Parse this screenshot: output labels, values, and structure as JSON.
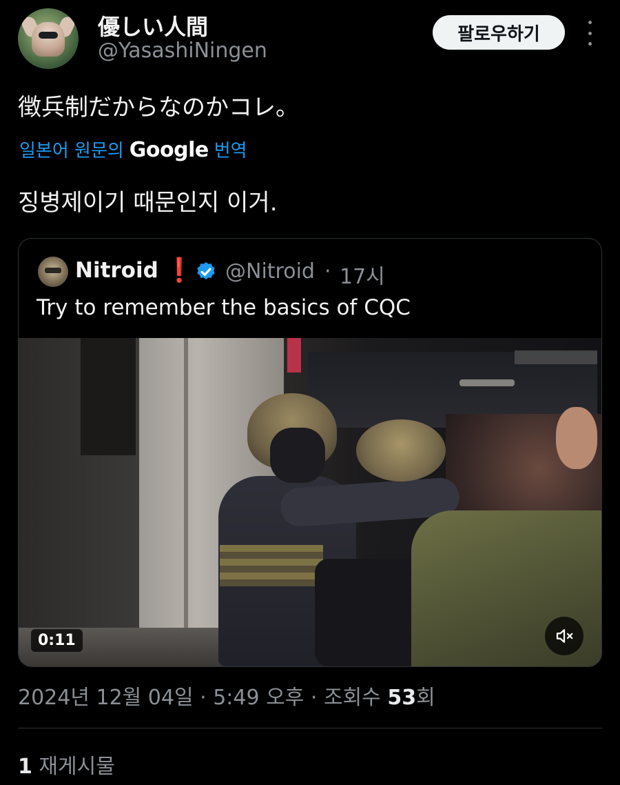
{
  "author": {
    "display_name": "優しい人間",
    "handle": "@YasashiNingen",
    "follow_label": "팔로우하기"
  },
  "tweet": {
    "text": "徴兵制だからなのかコレ。",
    "translate_prefix": "일본어 원문의",
    "translate_brand": "Google",
    "translate_suffix": "번역",
    "translated_text": "징병제이기 때문인지 이거."
  },
  "quote": {
    "name": "Nitroid",
    "name_badge": "❗",
    "handle": "@Nitroid",
    "separator": "·",
    "time": "17시",
    "text": "Try to remember the basics of CQC",
    "video_duration": "0:11",
    "verified_color": "#1d9bf0"
  },
  "meta": {
    "date": "2024년 12월 04일",
    "sep1": "·",
    "time": "5:49 오후",
    "sep2": "·",
    "views_prefix": "조회수",
    "views_count": "53",
    "views_suffix": "회"
  },
  "stats": {
    "repost_count": "1",
    "repost_label": "재게시물"
  },
  "icons": {
    "more": "more-vertical-icon",
    "verified": "verified-badge-icon",
    "mute": "speaker-muted-icon"
  },
  "colors": {
    "background": "#000000",
    "link": "#1d9bf0",
    "muted_text": "#8b9096",
    "exclamation": "#f4212e"
  }
}
